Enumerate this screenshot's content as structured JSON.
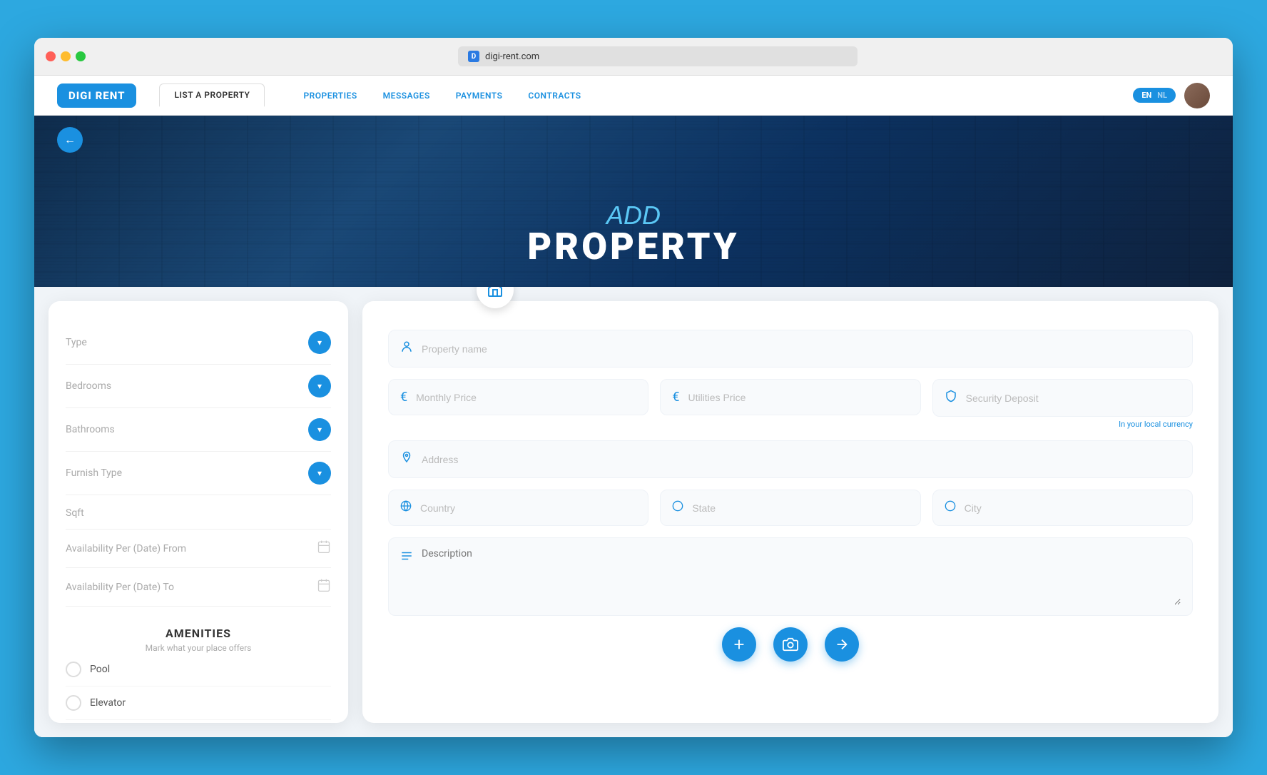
{
  "browser": {
    "url": "digi-rent.com",
    "favicon_label": "D"
  },
  "nav": {
    "logo": "DIGI RENT",
    "tabs": [
      {
        "label": "LIST A PROPERTY",
        "active": true
      }
    ],
    "links": [
      {
        "label": "PROPERTIES"
      },
      {
        "label": "MESSAGES"
      },
      {
        "label": "PAYMENTS"
      },
      {
        "label": "CONTRACTS"
      }
    ],
    "lang_en": "EN",
    "lang_nl": "NL"
  },
  "hero": {
    "add_text": "ADD",
    "property_text": "PROPERTY"
  },
  "left_panel": {
    "filters": [
      {
        "label": "Type",
        "has_dropdown": true
      },
      {
        "label": "Bedrooms",
        "has_dropdown": true
      },
      {
        "label": "Bathrooms",
        "has_dropdown": true
      },
      {
        "label": "Furnish Type",
        "has_dropdown": true
      },
      {
        "label": "Sqft",
        "has_dropdown": false
      },
      {
        "label": "Availability Per (Date) From",
        "has_calendar": true
      },
      {
        "label": "Availability Per (Date) To",
        "has_calendar": true
      }
    ],
    "amenities": {
      "title": "AMENITIES",
      "subtitle": "Mark what your place offers",
      "items": [
        {
          "label": "Pool"
        },
        {
          "label": "Elevator"
        }
      ]
    }
  },
  "right_panel": {
    "fields": {
      "property_name_placeholder": "Property name",
      "monthly_price_placeholder": "Monthly Price",
      "utilities_price_placeholder": "Utilities Price",
      "security_deposit_placeholder": "Security Deposit",
      "currency_hint": "In your local currency",
      "address_placeholder": "Address",
      "country_placeholder": "Country",
      "state_placeholder": "State",
      "city_placeholder": "City",
      "description_placeholder": "Description"
    }
  },
  "icons": {
    "back_arrow": "←",
    "chevron_down": "▾",
    "calendar": "📅",
    "house": "🏠",
    "person": "👤",
    "euro": "€",
    "shield": "🛡",
    "location_pin": "📍",
    "globe": "○",
    "lines": "≡",
    "plus": "+",
    "camera": "📷",
    "image": "🖼"
  }
}
